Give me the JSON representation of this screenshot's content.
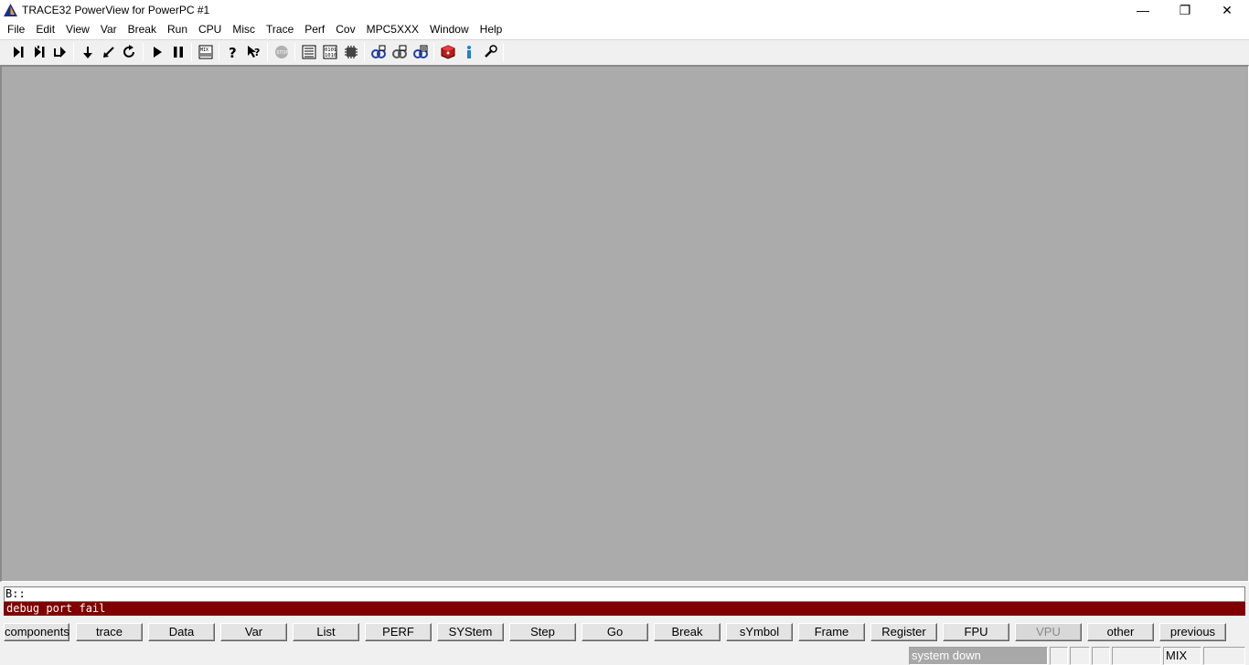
{
  "window": {
    "title": "TRACE32 PowerView for PowerPC #1",
    "logo_icon": "trace32-triangle-logo",
    "controls": {
      "minimize": "—",
      "maximize": "❐",
      "close": "✕"
    }
  },
  "menu": [
    "File",
    "Edit",
    "View",
    "Var",
    "Break",
    "Run",
    "CPU",
    "Misc",
    "Trace",
    "Perf",
    "Cov",
    "MPC5XXX",
    "Window",
    "Help"
  ],
  "toolbar": [
    "step-icon",
    "step-over-icon",
    "step-out-icon",
    "sep",
    "down-arrow-icon",
    "return-icon",
    "redo-icon",
    "sep",
    "go-icon",
    "pause-icon",
    "sep",
    "mode-icon",
    "sep",
    "help-icon",
    "context-help-icon",
    "sep",
    "stop-icon",
    "sep",
    "list-icon",
    "binary-icon",
    "chip-icon",
    "sep",
    "view-icon-1",
    "view-icon-2",
    "view-icon-3",
    "sep",
    "red-cube-icon",
    "info-icon",
    "wrench-icon",
    "sep"
  ],
  "command": {
    "prompt": "B::",
    "message": "debug port fail"
  },
  "softkeys": [
    {
      "label": "components",
      "disabled": false
    },
    {
      "label": "trace",
      "disabled": false
    },
    {
      "label": "Data",
      "disabled": false
    },
    {
      "label": "Var",
      "disabled": false
    },
    {
      "label": "List",
      "disabled": false
    },
    {
      "label": "PERF",
      "disabled": false
    },
    {
      "label": "SYStem",
      "disabled": false
    },
    {
      "label": "Step",
      "disabled": false
    },
    {
      "label": "Go",
      "disabled": false
    },
    {
      "label": "Break",
      "disabled": false
    },
    {
      "label": "sYmbol",
      "disabled": false
    },
    {
      "label": "Frame",
      "disabled": false
    },
    {
      "label": "Register",
      "disabled": false
    },
    {
      "label": "FPU",
      "disabled": false
    },
    {
      "label": "VPU",
      "disabled": true
    },
    {
      "label": "other",
      "disabled": false
    },
    {
      "label": "previous",
      "disabled": false
    }
  ],
  "status": {
    "system": "system down",
    "mode": "MIX"
  },
  "colors": {
    "workspace": "#ababab",
    "message_bg": "#800000",
    "accent": "#1f3fa8"
  }
}
